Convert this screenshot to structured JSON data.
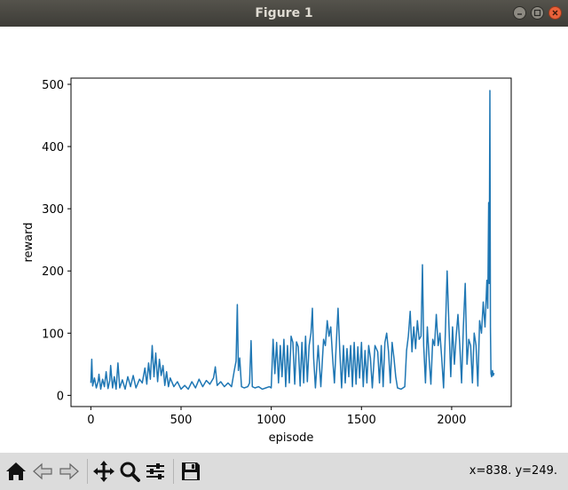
{
  "window": {
    "title": "Figure 1"
  },
  "toolbar": {
    "buttons": [
      {
        "name": "home-button",
        "icon": "home-icon"
      },
      {
        "name": "back-button",
        "icon": "arrow-left-icon"
      },
      {
        "name": "forward-button",
        "icon": "arrow-right-icon"
      },
      {
        "name": "pan-button",
        "icon": "move-icon"
      },
      {
        "name": "zoom-button",
        "icon": "magnifier-icon"
      },
      {
        "name": "configure-subplots-button",
        "icon": "sliders-icon"
      },
      {
        "name": "save-button",
        "icon": "floppy-disk-icon"
      }
    ],
    "coordinates": "x=838. y=249."
  },
  "chart_data": {
    "type": "line",
    "xlabel": "episode",
    "ylabel": "reward",
    "xlim": [
      -110,
      2330
    ],
    "ylim": [
      -18,
      510
    ],
    "xticks": [
      0,
      500,
      1000,
      1500,
      2000
    ],
    "yticks": [
      0,
      100,
      200,
      300,
      400,
      500
    ],
    "grid": false,
    "color": "#1f77b4",
    "series": [
      {
        "points": [
          [
            0,
            20
          ],
          [
            5,
            58
          ],
          [
            10,
            15
          ],
          [
            20,
            28
          ],
          [
            30,
            12
          ],
          [
            40,
            22
          ],
          [
            45,
            34
          ],
          [
            55,
            10
          ],
          [
            65,
            26
          ],
          [
            75,
            14
          ],
          [
            85,
            38
          ],
          [
            95,
            11
          ],
          [
            105,
            24
          ],
          [
            110,
            48
          ],
          [
            120,
            12
          ],
          [
            130,
            30
          ],
          [
            140,
            10
          ],
          [
            150,
            52
          ],
          [
            160,
            12
          ],
          [
            175,
            25
          ],
          [
            190,
            10
          ],
          [
            205,
            30
          ],
          [
            220,
            14
          ],
          [
            235,
            32
          ],
          [
            250,
            12
          ],
          [
            270,
            26
          ],
          [
            285,
            20
          ],
          [
            300,
            44
          ],
          [
            310,
            18
          ],
          [
            320,
            52
          ],
          [
            330,
            26
          ],
          [
            340,
            80
          ],
          [
            350,
            30
          ],
          [
            360,
            68
          ],
          [
            370,
            22
          ],
          [
            380,
            58
          ],
          [
            390,
            32
          ],
          [
            400,
            48
          ],
          [
            410,
            16
          ],
          [
            420,
            38
          ],
          [
            430,
            14
          ],
          [
            440,
            28
          ],
          [
            460,
            14
          ],
          [
            480,
            22
          ],
          [
            500,
            10
          ],
          [
            520,
            16
          ],
          [
            540,
            10
          ],
          [
            560,
            22
          ],
          [
            580,
            12
          ],
          [
            600,
            26
          ],
          [
            620,
            14
          ],
          [
            640,
            24
          ],
          [
            660,
            18
          ],
          [
            680,
            28
          ],
          [
            690,
            46
          ],
          [
            700,
            16
          ],
          [
            720,
            22
          ],
          [
            740,
            14
          ],
          [
            760,
            20
          ],
          [
            780,
            14
          ],
          [
            795,
            40
          ],
          [
            805,
            55
          ],
          [
            812,
            146
          ],
          [
            818,
            40
          ],
          [
            825,
            60
          ],
          [
            835,
            14
          ],
          [
            850,
            12
          ],
          [
            870,
            14
          ],
          [
            880,
            20
          ],
          [
            888,
            88
          ],
          [
            895,
            14
          ],
          [
            910,
            12
          ],
          [
            930,
            14
          ],
          [
            950,
            10
          ],
          [
            970,
            12
          ],
          [
            990,
            14
          ],
          [
            1000,
            12
          ],
          [
            1010,
            90
          ],
          [
            1020,
            35
          ],
          [
            1030,
            85
          ],
          [
            1040,
            20
          ],
          [
            1050,
            80
          ],
          [
            1060,
            30
          ],
          [
            1070,
            90
          ],
          [
            1080,
            14
          ],
          [
            1090,
            80
          ],
          [
            1100,
            20
          ],
          [
            1110,
            95
          ],
          [
            1120,
            85
          ],
          [
            1130,
            18
          ],
          [
            1140,
            86
          ],
          [
            1150,
            78
          ],
          [
            1160,
            15
          ],
          [
            1170,
            85
          ],
          [
            1180,
            20
          ],
          [
            1190,
            95
          ],
          [
            1200,
            22
          ],
          [
            1210,
            80
          ],
          [
            1220,
            100
          ],
          [
            1228,
            140
          ],
          [
            1235,
            60
          ],
          [
            1245,
            12
          ],
          [
            1260,
            80
          ],
          [
            1275,
            14
          ],
          [
            1290,
            90
          ],
          [
            1300,
            80
          ],
          [
            1310,
            120
          ],
          [
            1320,
            95
          ],
          [
            1330,
            110
          ],
          [
            1340,
            60
          ],
          [
            1350,
            20
          ],
          [
            1360,
            80
          ],
          [
            1370,
            140
          ],
          [
            1380,
            70
          ],
          [
            1390,
            12
          ],
          [
            1400,
            80
          ],
          [
            1410,
            20
          ],
          [
            1420,
            75
          ],
          [
            1430,
            30
          ],
          [
            1440,
            80
          ],
          [
            1450,
            14
          ],
          [
            1460,
            85
          ],
          [
            1470,
            18
          ],
          [
            1480,
            78
          ],
          [
            1490,
            28
          ],
          [
            1500,
            85
          ],
          [
            1510,
            14
          ],
          [
            1520,
            72
          ],
          [
            1530,
            20
          ],
          [
            1540,
            80
          ],
          [
            1550,
            60
          ],
          [
            1560,
            12
          ],
          [
            1575,
            80
          ],
          [
            1590,
            70
          ],
          [
            1600,
            20
          ],
          [
            1610,
            80
          ],
          [
            1620,
            14
          ],
          [
            1630,
            85
          ],
          [
            1640,
            100
          ],
          [
            1650,
            70
          ],
          [
            1660,
            20
          ],
          [
            1670,
            85
          ],
          [
            1680,
            60
          ],
          [
            1690,
            30
          ],
          [
            1700,
            12
          ],
          [
            1720,
            10
          ],
          [
            1740,
            14
          ],
          [
            1750,
            72
          ],
          [
            1760,
            95
          ],
          [
            1770,
            135
          ],
          [
            1780,
            70
          ],
          [
            1790,
            110
          ],
          [
            1800,
            75
          ],
          [
            1810,
            120
          ],
          [
            1820,
            90
          ],
          [
            1830,
            95
          ],
          [
            1838,
            210
          ],
          [
            1845,
            80
          ],
          [
            1855,
            20
          ],
          [
            1865,
            110
          ],
          [
            1875,
            60
          ],
          [
            1885,
            18
          ],
          [
            1895,
            90
          ],
          [
            1905,
            80
          ],
          [
            1915,
            130
          ],
          [
            1925,
            80
          ],
          [
            1935,
            100
          ],
          [
            1945,
            60
          ],
          [
            1955,
            12
          ],
          [
            1965,
            100
          ],
          [
            1975,
            200
          ],
          [
            1985,
            110
          ],
          [
            1995,
            30
          ],
          [
            2005,
            110
          ],
          [
            2015,
            50
          ],
          [
            2025,
            95
          ],
          [
            2035,
            130
          ],
          [
            2045,
            80
          ],
          [
            2055,
            20
          ],
          [
            2065,
            110
          ],
          [
            2075,
            180
          ],
          [
            2085,
            50
          ],
          [
            2095,
            90
          ],
          [
            2105,
            80
          ],
          [
            2115,
            20
          ],
          [
            2125,
            100
          ],
          [
            2135,
            80
          ],
          [
            2145,
            15
          ],
          [
            2155,
            120
          ],
          [
            2165,
            100
          ],
          [
            2175,
            150
          ],
          [
            2185,
            110
          ],
          [
            2195,
            185
          ],
          [
            2200,
            140
          ],
          [
            2205,
            310
          ],
          [
            2208,
            180
          ],
          [
            2212,
            490
          ],
          [
            2215,
            110
          ],
          [
            2218,
            35
          ],
          [
            2222,
            30
          ],
          [
            2226,
            40
          ],
          [
            2230,
            32
          ],
          [
            2235,
            36
          ]
        ]
      }
    ]
  }
}
